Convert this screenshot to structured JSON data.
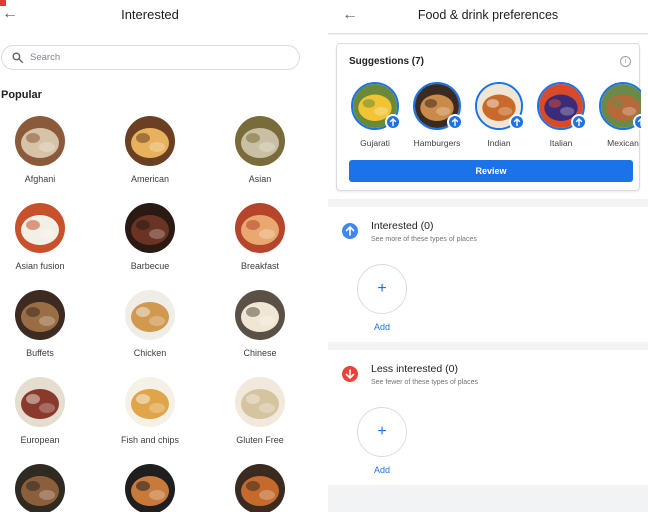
{
  "left": {
    "title": "Interested",
    "search_placeholder": "Search",
    "section_title": "Popular",
    "items": [
      {
        "label": "Afghani",
        "colors": [
          "#d7c3a8",
          "#8a5a3a"
        ]
      },
      {
        "label": "American",
        "colors": [
          "#e7b25b",
          "#6b3f23"
        ]
      },
      {
        "label": "Asian",
        "colors": [
          "#c9c0a3",
          "#7a6b3a"
        ]
      },
      {
        "label": "Asian fusion",
        "colors": [
          "#f2efe6",
          "#c6512b"
        ]
      },
      {
        "label": "Barbecue",
        "colors": [
          "#6b3324",
          "#2b1a14"
        ]
      },
      {
        "label": "Breakfast",
        "colors": [
          "#e9a870",
          "#b5462b"
        ]
      },
      {
        "label": "Buffets",
        "colors": [
          "#9a6e44",
          "#3d2b22"
        ]
      },
      {
        "label": "Chicken",
        "colors": [
          "#d19850",
          "#f0ede6"
        ]
      },
      {
        "label": "Chinese",
        "colors": [
          "#efe7d3",
          "#5b5046"
        ]
      },
      {
        "label": "European",
        "colors": [
          "#8a3a2d",
          "#e4ddd0"
        ]
      },
      {
        "label": "Fish and chips",
        "colors": [
          "#e0a449",
          "#f6f1e6"
        ]
      },
      {
        "label": "Gluten Free",
        "colors": [
          "#d6c4a0",
          "#f0e9dc"
        ]
      },
      {
        "label": "",
        "colors": [
          "#8b5e3c",
          "#2f2a22"
        ]
      },
      {
        "label": "",
        "colors": [
          "#c77a3a",
          "#1f1f1f"
        ]
      },
      {
        "label": "",
        "colors": [
          "#c46a2c",
          "#3a2a1f"
        ]
      }
    ]
  },
  "right": {
    "title": "Food & drink preferences",
    "suggestions_title": "Suggestions (7)",
    "suggestions": [
      {
        "label": "Gujarati",
        "colors": [
          "#f2c433",
          "#6a8a3a"
        ]
      },
      {
        "label": "Hamburgers",
        "colors": [
          "#c98a4a",
          "#3a2a22"
        ]
      },
      {
        "label": "Indian",
        "colors": [
          "#c96a2a",
          "#f0e6d6"
        ]
      },
      {
        "label": "Italian",
        "colors": [
          "#3b2c7a",
          "#d84a2a"
        ]
      },
      {
        "label": "Mexican",
        "colors": [
          "#b66a3a",
          "#6a8a4a"
        ]
      }
    ],
    "review_label": "Review",
    "interested": {
      "title": "Interested (0)",
      "subtitle": "See more of these types of places",
      "add_label": "Add",
      "icon_color": "#4285f4"
    },
    "less": {
      "title": "Less interested (0)",
      "subtitle": "See fewer of these types of places",
      "add_label": "Add",
      "icon_color": "#ea4335"
    }
  },
  "colors": {
    "accent": "#1a73e8"
  }
}
